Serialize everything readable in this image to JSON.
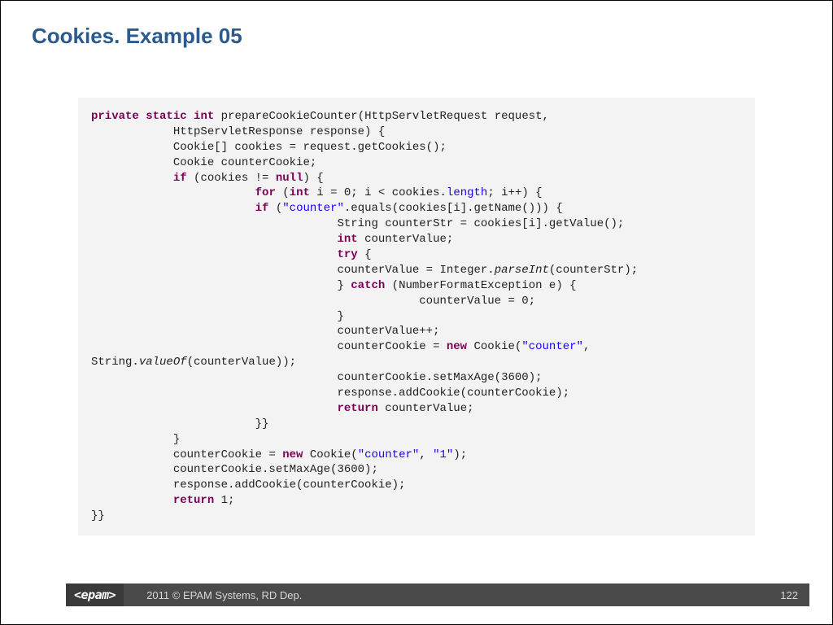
{
  "title": "Cookies. Example 05",
  "footer": {
    "logo": "<epam>",
    "text": "2011 © EPAM Systems, RD Dep.",
    "page": "122"
  },
  "code": {
    "lines": [
      {
        "indent": 0,
        "tokens": [
          {
            "t": "private",
            "c": "kw"
          },
          {
            "t": " "
          },
          {
            "t": "static",
            "c": "kw"
          },
          {
            "t": " "
          },
          {
            "t": "int",
            "c": "kw"
          },
          {
            "t": " prepareCookieCounter(HttpServletRequest request,"
          }
        ]
      },
      {
        "indent": 12,
        "tokens": [
          {
            "t": "HttpServletResponse response) {"
          }
        ]
      },
      {
        "indent": 12,
        "tokens": [
          {
            "t": "Cookie[] cookies = request.getCookies();"
          }
        ]
      },
      {
        "indent": 12,
        "tokens": [
          {
            "t": "Cookie counterCookie;"
          }
        ]
      },
      {
        "indent": 12,
        "tokens": [
          {
            "t": "if",
            "c": "kw"
          },
          {
            "t": " (cookies != "
          },
          {
            "t": "null",
            "c": "kw"
          },
          {
            "t": ") {"
          }
        ]
      },
      {
        "indent": 24,
        "tokens": [
          {
            "t": "for",
            "c": "kw"
          },
          {
            "t": " ("
          },
          {
            "t": "int",
            "c": "kw"
          },
          {
            "t": " i = 0; i < cookies."
          },
          {
            "t": "length",
            "c": "str"
          },
          {
            "t": "; i++) {"
          }
        ]
      },
      {
        "indent": 24,
        "tokens": [
          {
            "t": "if",
            "c": "kw"
          },
          {
            "t": " ("
          },
          {
            "t": "\"counter\"",
            "c": "str"
          },
          {
            "t": ".equals(cookies[i].getName())) {"
          }
        ]
      },
      {
        "indent": 36,
        "tokens": [
          {
            "t": "String counterStr = cookies[i].getValue();"
          }
        ]
      },
      {
        "indent": 36,
        "tokens": [
          {
            "t": "int",
            "c": "kw"
          },
          {
            "t": " counterValue;"
          }
        ]
      },
      {
        "indent": 36,
        "tokens": [
          {
            "t": "try",
            "c": "kw"
          },
          {
            "t": " {"
          }
        ]
      },
      {
        "indent": 36,
        "tokens": [
          {
            "t": "counterValue = Integer."
          },
          {
            "t": "parseInt",
            "c": "it"
          },
          {
            "t": "(counterStr);"
          }
        ]
      },
      {
        "indent": 36,
        "tokens": [
          {
            "t": "} "
          },
          {
            "t": "catch",
            "c": "kw"
          },
          {
            "t": " (NumberFormatException e) {"
          }
        ]
      },
      {
        "indent": 48,
        "tokens": [
          {
            "t": "counterValue = 0;"
          }
        ]
      },
      {
        "indent": 36,
        "tokens": [
          {
            "t": "}"
          }
        ]
      },
      {
        "indent": 36,
        "tokens": [
          {
            "t": "counterValue++;"
          }
        ]
      },
      {
        "indent": 36,
        "tokens": [
          {
            "t": "counterCookie = "
          },
          {
            "t": "new",
            "c": "kw"
          },
          {
            "t": " Cookie("
          },
          {
            "t": "\"counter\"",
            "c": "str"
          },
          {
            "t": ","
          }
        ]
      },
      {
        "indent": -1,
        "tokens": [
          {
            "t": "String."
          },
          {
            "t": "valueOf",
            "c": "it"
          },
          {
            "t": "(counterValue));"
          }
        ]
      },
      {
        "indent": 36,
        "tokens": [
          {
            "t": "counterCookie.setMaxAge(3600);"
          }
        ]
      },
      {
        "indent": 36,
        "tokens": [
          {
            "t": "response.addCookie(counterCookie);"
          }
        ]
      },
      {
        "indent": 36,
        "tokens": [
          {
            "t": "return",
            "c": "kw"
          },
          {
            "t": " counterValue;"
          }
        ]
      },
      {
        "indent": 24,
        "tokens": [
          {
            "t": "}}"
          }
        ]
      },
      {
        "indent": 12,
        "tokens": [
          {
            "t": "}"
          }
        ]
      },
      {
        "indent": 12,
        "tokens": [
          {
            "t": "counterCookie = "
          },
          {
            "t": "new",
            "c": "kw"
          },
          {
            "t": " Cookie("
          },
          {
            "t": "\"counter\"",
            "c": "str"
          },
          {
            "t": ", "
          },
          {
            "t": "\"1\"",
            "c": "str"
          },
          {
            "t": ");"
          }
        ]
      },
      {
        "indent": 12,
        "tokens": [
          {
            "t": "counterCookie.setMaxAge(3600);"
          }
        ]
      },
      {
        "indent": 12,
        "tokens": [
          {
            "t": "response.addCookie(counterCookie);"
          }
        ]
      },
      {
        "indent": 12,
        "tokens": [
          {
            "t": "return",
            "c": "kw"
          },
          {
            "t": " 1;"
          }
        ]
      },
      {
        "indent": 0,
        "tokens": [
          {
            "t": "}}"
          }
        ]
      }
    ]
  }
}
